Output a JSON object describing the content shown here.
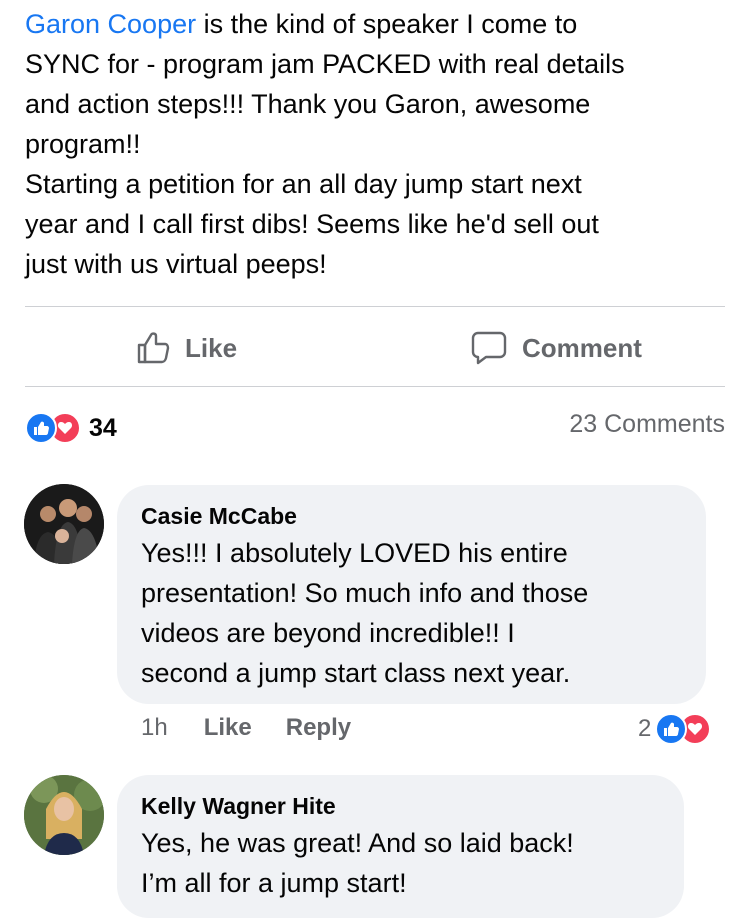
{
  "post": {
    "mention": "Garon Cooper",
    "text_lines": [
      " is the kind of speaker I come to",
      "SYNC for - program jam PACKED with real details",
      "and action steps!!! Thank you Garon, awesome",
      "program!!",
      "Starting a petition for an all day jump start next",
      "year and I call first dibs! Seems like he'd sell out",
      "just with us virtual peeps!"
    ]
  },
  "actions": {
    "like_label": "Like",
    "comment_label": "Comment"
  },
  "stats": {
    "reaction_count": "34",
    "comments_label": "23 Comments"
  },
  "comments": [
    {
      "author": "Casie McCabe",
      "lines": [
        "Yes!!! I absolutely LOVED his entire",
        "presentation! So much info and those",
        "videos are beyond incredible!! I",
        "second a jump start class next year."
      ],
      "time": "1h",
      "like_label": "Like",
      "reply_label": "Reply",
      "reaction_count": "2"
    },
    {
      "author": "Kelly Wagner Hite",
      "lines": [
        "Yes, he was great! And so laid back!",
        "I’m all for a jump start!"
      ]
    }
  ],
  "colors": {
    "link": "#1877f2",
    "like_reaction": "#1877f2",
    "love_reaction": "#f33e58",
    "secondary_text": "#65676b",
    "bubble": "#f0f2f5"
  },
  "icons": [
    "thumbs-up-icon",
    "comment-bubble-icon",
    "like-reaction-icon",
    "love-reaction-icon"
  ]
}
